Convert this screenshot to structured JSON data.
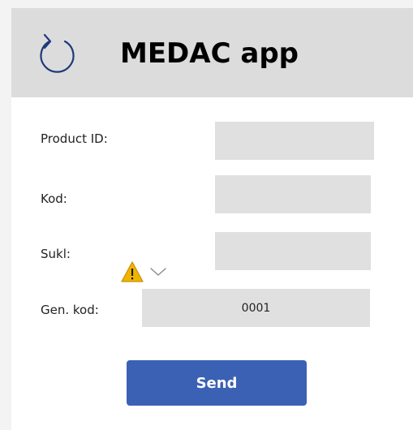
{
  "header": {
    "title": "MEDAC app",
    "icon": "refresh-icon",
    "background": "#dcdcdc"
  },
  "form": {
    "fields": [
      {
        "label": "Product ID:",
        "value": ""
      },
      {
        "label": "Kod:",
        "value": ""
      },
      {
        "label": "Sukl:",
        "value": ""
      },
      {
        "label": "Gen. kod:",
        "value": "0001"
      }
    ],
    "warning_icon": "warning-icon",
    "dropdown_icon": "chevron-down-icon"
  },
  "actions": {
    "send_label": "Send",
    "send_color": "#3b61b5"
  },
  "colors": {
    "icon_stroke": "#1f3a7a",
    "field_bg": "#e0e0e0",
    "warning_fill": "#f0b400"
  }
}
